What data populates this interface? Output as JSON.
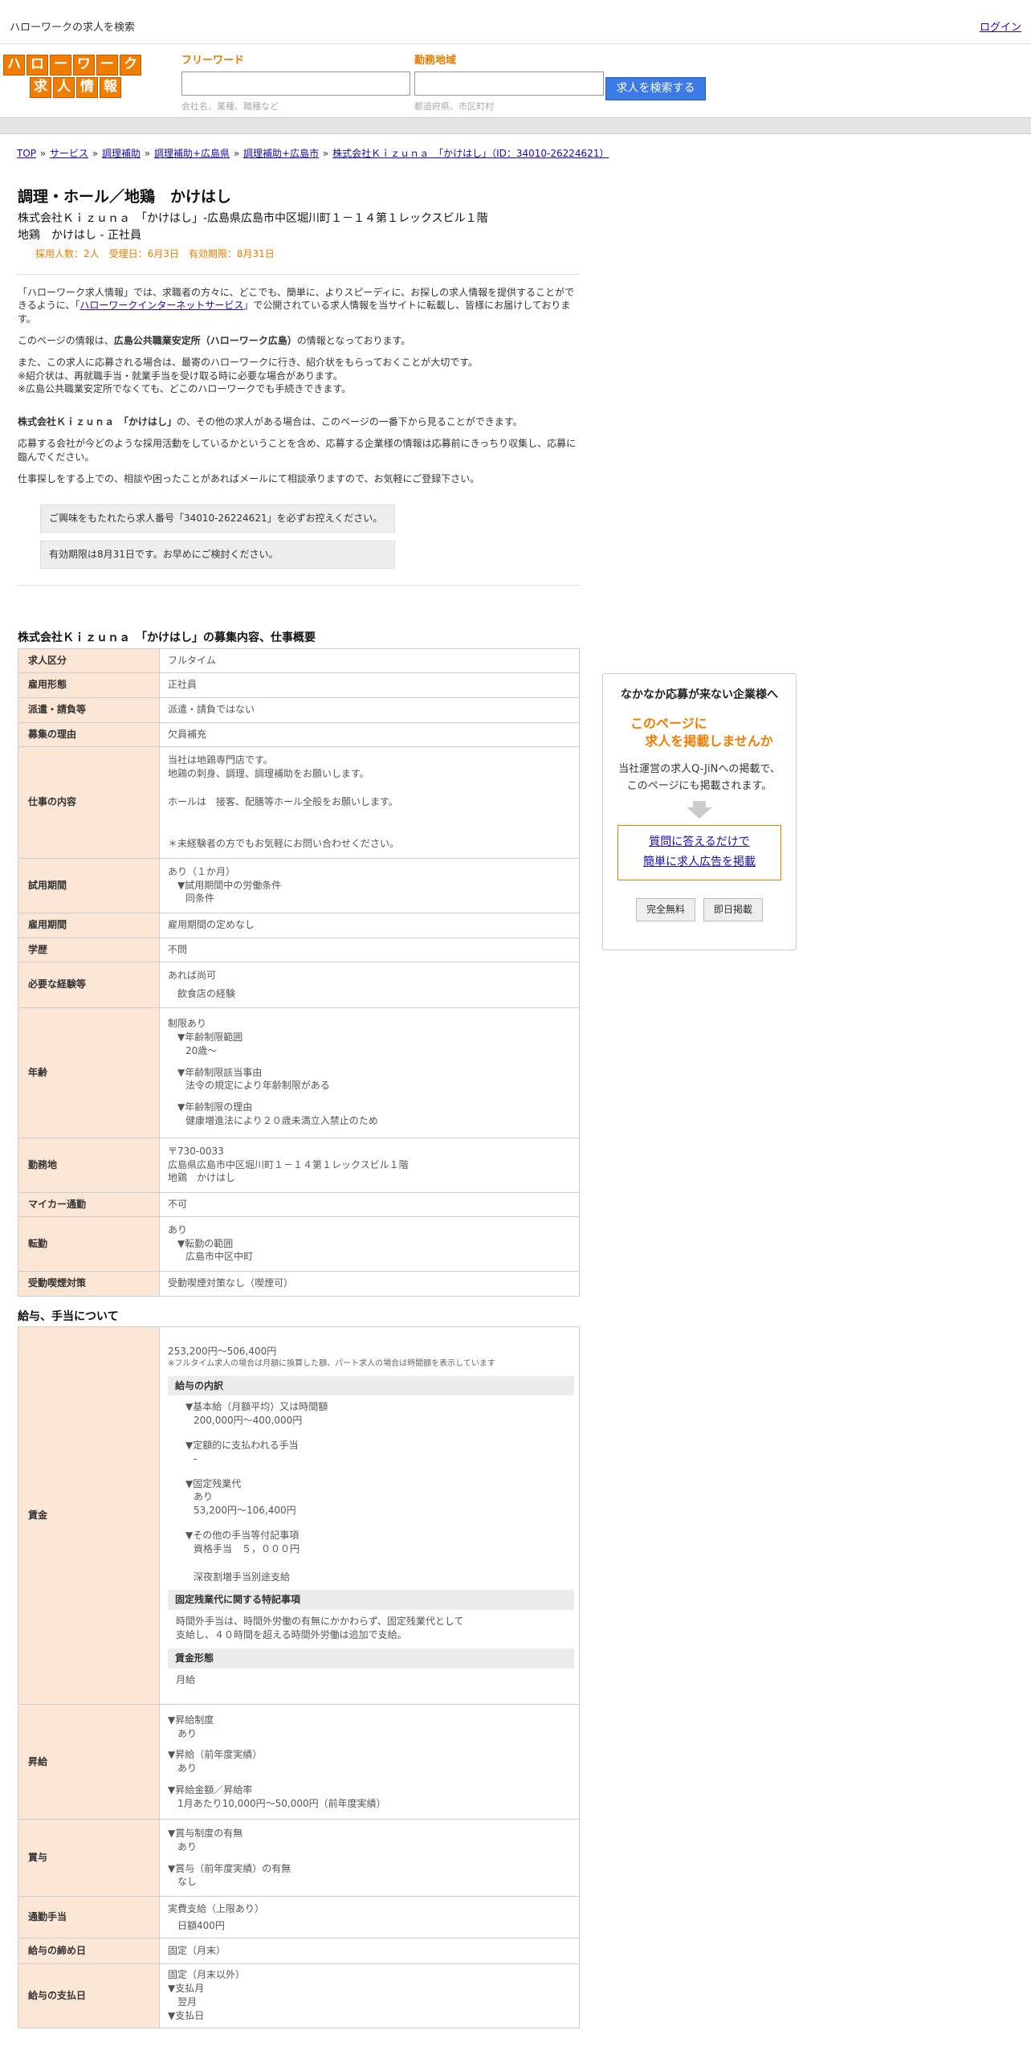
{
  "topbar": {
    "title": "ハローワークの求人を検索",
    "login": "ログイン"
  },
  "logo": {
    "row1": [
      "ハ",
      "ロ",
      "ー",
      "ワ",
      "ー",
      "ク"
    ],
    "row2": [
      "求",
      "人",
      "情",
      "報"
    ]
  },
  "search": {
    "keyword_label": "フリーワード",
    "keyword_placeholder": "会社名、業種、職種など",
    "area_label": "勤務地域",
    "area_placeholder": "都道府県、市区町村",
    "button": "求人を検索する"
  },
  "breadcrumb": {
    "items": [
      "TOP",
      "サービス",
      "調理補助",
      "調理補助+広島県",
      "調理補助+広島市",
      "株式会社Ｋｉｚｕｎａ　「かけはし」（ID：34010-26224621）"
    ],
    "sep": " » "
  },
  "job": {
    "title": "調理・ホール／地鶏　かけはし",
    "company_line": "株式会社Ｋｉｚｕｎａ　「かけはし」-広島県広島市中区堀川町１－１４第１レックスビル１階",
    "type_line": "地鶏　かけはし - 正社員",
    "meta": "採用人数：2人　受理日：6月3日　有効期限：8月31日"
  },
  "intro": {
    "p1_a": "「ハローワーク求人情報」では、求職者の方々に、どこでも、簡単に、よりスピーディに、お探しの求人情報を提供することができるように、「",
    "p1_link": "ハローワークインターネットサービス",
    "p1_b": "」で公開されている求人情報を当サイトに転載し、皆様にお届けしております。",
    "p2_a": "このページの情報は、",
    "p2_bold": "広島公共職業安定所（ハローワーク広島）",
    "p2_b": "の情報となっております。",
    "p3_l1": "また、この求人に応募される場合は、最寄のハローワークに行き、紹介状をもらっておくことが大切です。",
    "p3_l2": "※紹介状は、再就職手当・就業手当を受け取る時に必要な場合があります。",
    "p3_l3": "※広島公共職業安定所でなくても、どこのハローワークでも手続きできます。",
    "p4_bold": "株式会社Ｋｉｚｕｎａ　「かけはし」",
    "p4_b": "の、その他の求人がある場合は、このページの一番下から見ることができます。",
    "p5": "応募する会社が今どのような採用活動をしているかということを含め、応募する企業様の情報は応募前にきっちり収集し、応募に臨んでください。",
    "p6": "仕事探しをする上での、相談や困ったことがあればメールにて相談承りますので、お気軽にご登録下さい。",
    "notice1": "ご興味をもたれたら求人番号「34010-26224621」を必ずお控えください。",
    "notice2": "有効期限は8月31日です。お早めにご検討ください。"
  },
  "overview": {
    "title": "株式会社Ｋｉｚｕｎａ　「かけはし」の募集内容、仕事概要",
    "rows": {
      "kubun": {
        "th": "求人区分",
        "v": "フルタイム"
      },
      "koyo": {
        "th": "雇用形態",
        "v": "正社員"
      },
      "haken": {
        "th": "派遣・請負等",
        "v": "派遣・請負ではない"
      },
      "riyu": {
        "th": "募集の理由",
        "v": "欠員補充"
      },
      "naiyo": {
        "th": "仕事の内容",
        "l1": "当社は地鶏専門店です。",
        "l2": "地鶏の刺身、調理、調理補助をお願いします。",
        "l3": "ホールは　接客、配膳等ホール全般をお願いします。",
        "l4": "＊未経験者の方でもお気軽にお問い合わせください。"
      },
      "shiyo": {
        "th": "試用期間",
        "l1": "あり（１か月）",
        "l2": "▼試用期間中の労働条件",
        "l3": "同条件"
      },
      "kikan": {
        "th": "雇用期間",
        "v": "雇用期間の定めなし"
      },
      "gakureki": {
        "th": "学歴",
        "v": "不問"
      },
      "keiken": {
        "th": "必要な経験等",
        "l1": "あれば尚可",
        "l2": "飲食店の経験"
      },
      "nenrei": {
        "th": "年齢",
        "l1": "制限あり",
        "l2": "▼年齢制限範囲",
        "l3": "20歳～",
        "l4": "▼年齢制限該当事由",
        "l5": "法令の規定により年齢制限がある",
        "l6": "▼年齢制限の理由",
        "l7": "健康増進法により２０歳未満立入禁止のため"
      },
      "kinmuchi": {
        "th": "勤務地",
        "l1": "〒730-0033",
        "l2": "広島県広島市中区堀川町１－１４第１レックスビル１階",
        "l3": "地鶏　かけはし"
      },
      "mycar": {
        "th": "マイカー通勤",
        "v": "不可"
      },
      "tenkin": {
        "th": "転勤",
        "l1": "あり",
        "l2": "▼転勤の範囲",
        "l3": "広島市中区中町"
      },
      "kitsuen": {
        "th": "受動喫煙対策",
        "v": "受動喫煙対策なし（喫煙可）"
      }
    }
  },
  "salary": {
    "title": "給与、手当について",
    "chingin": {
      "th": "賃金",
      "range": "253,200円〜506,400円",
      "note": "※フルタイム求人の場合は月額に換算した額、パート求人の場合は時間額を表示しています",
      "breakdown_h": "給与の内訳",
      "b1": "▼基本給（月額平均）又は時間額",
      "b1v": "200,000円〜400,000円",
      "b2": "▼定額的に支払われる手当",
      "b2v": "-",
      "b3": "▼固定残業代",
      "b3v1": "あり",
      "b3v2": "53,200円〜106,400円",
      "b4": "▼その他の手当等付記事項",
      "b4v": "資格手当　５，０００円",
      "b5": "深夜割増手当別途支給",
      "fixed_h": "固定残業代に関する特記事項",
      "fixed_l1": "時間外手当は、時間外労働の有無にかかわらず、固定残業代として",
      "fixed_l2": "支給し、４０時間を超える時間外労働は追加で支給。",
      "form_h": "賃金形態",
      "form_v": "月給"
    },
    "shokyu": {
      "th": "昇給",
      "l1": "▼昇給制度",
      "l2": "あり",
      "l3": "▼昇給（前年度実績）",
      "l4": "あり",
      "l5": "▼昇給金額／昇給率",
      "l6": "1月あたり10,000円〜50,000円（前年度実績）"
    },
    "shoyo": {
      "th": "賞与",
      "l1": "▼賞与制度の有無",
      "l2": "あり",
      "l3": "▼賞与（前年度実績）の有無",
      "l4": "なし"
    },
    "tsukin": {
      "th": "通勤手当",
      "l1": "実費支給（上限あり）",
      "l2": "日額400円"
    },
    "shimebi": {
      "th": "給与の締め日",
      "v": "固定（月末）"
    },
    "shiharai": {
      "th": "給与の支払日",
      "l1": "固定（月末以外）",
      "l2": "▼支払月",
      "l3": "翌月",
      "l4": "▼支払日"
    }
  },
  "sidebar": {
    "heading": "なかなか応募が来ない企業様へ",
    "catch1": "このページに",
    "catch2": "求人を掲載しませんか",
    "desc1": "当社運営の求人Q-JiNへの掲載で、",
    "desc2": "このページにも掲載されます。",
    "link1": "質問に答えるだけで",
    "link2": "簡単に求人広告を掲載",
    "btn1": "完全無料",
    "btn2": "即日掲載"
  }
}
